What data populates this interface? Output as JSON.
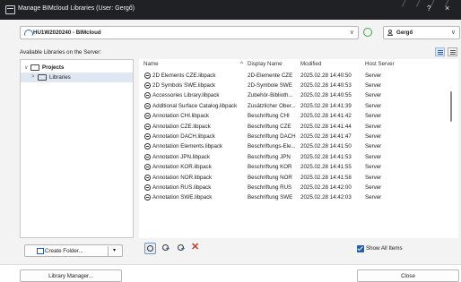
{
  "window": {
    "title": "Manage BIMcloud Libraries (User: Gergő)",
    "help": "?",
    "close": "×"
  },
  "server_select": {
    "value": "HU1W2020240 - BIMcloud"
  },
  "user_select": {
    "value": "Gergő"
  },
  "available_label": "Available Libraries on the Server:",
  "tree": [
    {
      "label": "Projects",
      "caret": "∨"
    },
    {
      "label": "Libraries",
      "caret": ">"
    }
  ],
  "table": {
    "columns": [
      "Name",
      "Display Name",
      "Modified",
      "Host Server"
    ],
    "sort_indicator": "^",
    "rows": [
      {
        "name": "2D Elements CZE.libpack",
        "display": "2D-Elemente CZE",
        "modified": "2025.02.28 14:40:50",
        "server": "Server"
      },
      {
        "name": "2D Symbols SWE.libpack",
        "display": "2D-Symbole SWE",
        "modified": "2025.02.28 14:40:53",
        "server": "Server"
      },
      {
        "name": "Accessories Library.libpack",
        "display": "Zubehör-Biblioth...",
        "modified": "2025.02.28 14:40:55",
        "server": "Server"
      },
      {
        "name": "Additional Surface Catalog.libpack",
        "display": "Zusätzlicher Ober...",
        "modified": "2025.02.28 14:41:39",
        "server": "Server"
      },
      {
        "name": "Annotation CHI.libpack",
        "display": "Beschriftung CHI",
        "modified": "2025.02.28 14:41:42",
        "server": "Server"
      },
      {
        "name": "Annotation CZE.libpack",
        "display": "Beschriftung CZE",
        "modified": "2025.02.28 14:41:44",
        "server": "Server"
      },
      {
        "name": "Annotation DACH.libpack",
        "display": "Beschriftung DACH",
        "modified": "2025.02.28 14:41:47",
        "server": "Server"
      },
      {
        "name": "Annotation Elements.libpack",
        "display": "Beschriftungs-Ele...",
        "modified": "2025.02.28 14:41:50",
        "server": "Server"
      },
      {
        "name": "Annotation JPN.libpack",
        "display": "Beschriftung JPN",
        "modified": "2025.02.28 14:41:53",
        "server": "Server"
      },
      {
        "name": "Annotation KOR.libpack",
        "display": "Beschriftung KOR",
        "modified": "2025.02.28 14:41:55",
        "server": "Server"
      },
      {
        "name": "Annotation NOR.libpack",
        "display": "Beschriftung NOR",
        "modified": "2025.02.28 14:41:58",
        "server": "Server"
      },
      {
        "name": "Annotation RUS.libpack",
        "display": "Beschriftung RUS",
        "modified": "2025.02.28 14:42:00",
        "server": "Server"
      },
      {
        "name": "Annotation SWE.libpack",
        "display": "Beschriftung SWE",
        "modified": "2025.02.28 14:42:03",
        "server": "Server"
      }
    ]
  },
  "create_folder": {
    "label": "Create Folder...",
    "chevron": "▾"
  },
  "delete_glyph": "✕",
  "show_all": {
    "label": "Show All Items",
    "checked": true
  },
  "library_manager": "Library Manager...",
  "close_button": "Close",
  "colors": {
    "accent": "#1f5fae",
    "titlebar": "#1f2125",
    "delete": "#c63a2a"
  }
}
